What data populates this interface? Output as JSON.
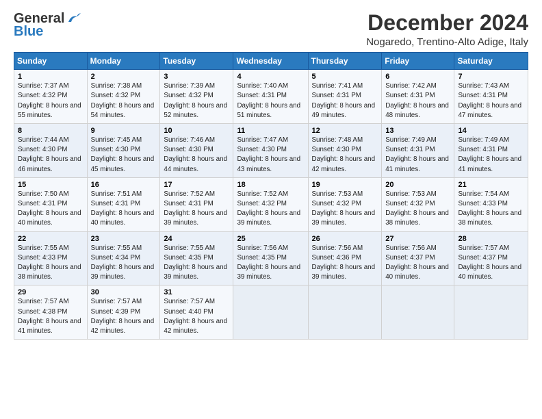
{
  "logo": {
    "line1": "General",
    "line2": "Blue"
  },
  "title": "December 2024",
  "subtitle": "Nogaredo, Trentino-Alto Adige, Italy",
  "days_header": [
    "Sunday",
    "Monday",
    "Tuesday",
    "Wednesday",
    "Thursday",
    "Friday",
    "Saturday"
  ],
  "weeks": [
    [
      {
        "day": "1",
        "sunrise": "7:37 AM",
        "sunset": "4:32 PM",
        "daylight": "8 hours and 55 minutes."
      },
      {
        "day": "2",
        "sunrise": "7:38 AM",
        "sunset": "4:32 PM",
        "daylight": "8 hours and 54 minutes."
      },
      {
        "day": "3",
        "sunrise": "7:39 AM",
        "sunset": "4:32 PM",
        "daylight": "8 hours and 52 minutes."
      },
      {
        "day": "4",
        "sunrise": "7:40 AM",
        "sunset": "4:31 PM",
        "daylight": "8 hours and 51 minutes."
      },
      {
        "day": "5",
        "sunrise": "7:41 AM",
        "sunset": "4:31 PM",
        "daylight": "8 hours and 49 minutes."
      },
      {
        "day": "6",
        "sunrise": "7:42 AM",
        "sunset": "4:31 PM",
        "daylight": "8 hours and 48 minutes."
      },
      {
        "day": "7",
        "sunrise": "7:43 AM",
        "sunset": "4:31 PM",
        "daylight": "8 hours and 47 minutes."
      }
    ],
    [
      {
        "day": "8",
        "sunrise": "7:44 AM",
        "sunset": "4:30 PM",
        "daylight": "8 hours and 46 minutes."
      },
      {
        "day": "9",
        "sunrise": "7:45 AM",
        "sunset": "4:30 PM",
        "daylight": "8 hours and 45 minutes."
      },
      {
        "day": "10",
        "sunrise": "7:46 AM",
        "sunset": "4:30 PM",
        "daylight": "8 hours and 44 minutes."
      },
      {
        "day": "11",
        "sunrise": "7:47 AM",
        "sunset": "4:30 PM",
        "daylight": "8 hours and 43 minutes."
      },
      {
        "day": "12",
        "sunrise": "7:48 AM",
        "sunset": "4:30 PM",
        "daylight": "8 hours and 42 minutes."
      },
      {
        "day": "13",
        "sunrise": "7:49 AM",
        "sunset": "4:31 PM",
        "daylight": "8 hours and 41 minutes."
      },
      {
        "day": "14",
        "sunrise": "7:49 AM",
        "sunset": "4:31 PM",
        "daylight": "8 hours and 41 minutes."
      }
    ],
    [
      {
        "day": "15",
        "sunrise": "7:50 AM",
        "sunset": "4:31 PM",
        "daylight": "8 hours and 40 minutes."
      },
      {
        "day": "16",
        "sunrise": "7:51 AM",
        "sunset": "4:31 PM",
        "daylight": "8 hours and 40 minutes."
      },
      {
        "day": "17",
        "sunrise": "7:52 AM",
        "sunset": "4:31 PM",
        "daylight": "8 hours and 39 minutes."
      },
      {
        "day": "18",
        "sunrise": "7:52 AM",
        "sunset": "4:32 PM",
        "daylight": "8 hours and 39 minutes."
      },
      {
        "day": "19",
        "sunrise": "7:53 AM",
        "sunset": "4:32 PM",
        "daylight": "8 hours and 39 minutes."
      },
      {
        "day": "20",
        "sunrise": "7:53 AM",
        "sunset": "4:32 PM",
        "daylight": "8 hours and 38 minutes."
      },
      {
        "day": "21",
        "sunrise": "7:54 AM",
        "sunset": "4:33 PM",
        "daylight": "8 hours and 38 minutes."
      }
    ],
    [
      {
        "day": "22",
        "sunrise": "7:55 AM",
        "sunset": "4:33 PM",
        "daylight": "8 hours and 38 minutes."
      },
      {
        "day": "23",
        "sunrise": "7:55 AM",
        "sunset": "4:34 PM",
        "daylight": "8 hours and 39 minutes."
      },
      {
        "day": "24",
        "sunrise": "7:55 AM",
        "sunset": "4:35 PM",
        "daylight": "8 hours and 39 minutes."
      },
      {
        "day": "25",
        "sunrise": "7:56 AM",
        "sunset": "4:35 PM",
        "daylight": "8 hours and 39 minutes."
      },
      {
        "day": "26",
        "sunrise": "7:56 AM",
        "sunset": "4:36 PM",
        "daylight": "8 hours and 39 minutes."
      },
      {
        "day": "27",
        "sunrise": "7:56 AM",
        "sunset": "4:37 PM",
        "daylight": "8 hours and 40 minutes."
      },
      {
        "day": "28",
        "sunrise": "7:57 AM",
        "sunset": "4:37 PM",
        "daylight": "8 hours and 40 minutes."
      }
    ],
    [
      {
        "day": "29",
        "sunrise": "7:57 AM",
        "sunset": "4:38 PM",
        "daylight": "8 hours and 41 minutes."
      },
      {
        "day": "30",
        "sunrise": "7:57 AM",
        "sunset": "4:39 PM",
        "daylight": "8 hours and 42 minutes."
      },
      {
        "day": "31",
        "sunrise": "7:57 AM",
        "sunset": "4:40 PM",
        "daylight": "8 hours and 42 minutes."
      },
      null,
      null,
      null,
      null
    ]
  ],
  "labels": {
    "sunrise": "Sunrise:",
    "sunset": "Sunset:",
    "daylight": "Daylight:"
  }
}
